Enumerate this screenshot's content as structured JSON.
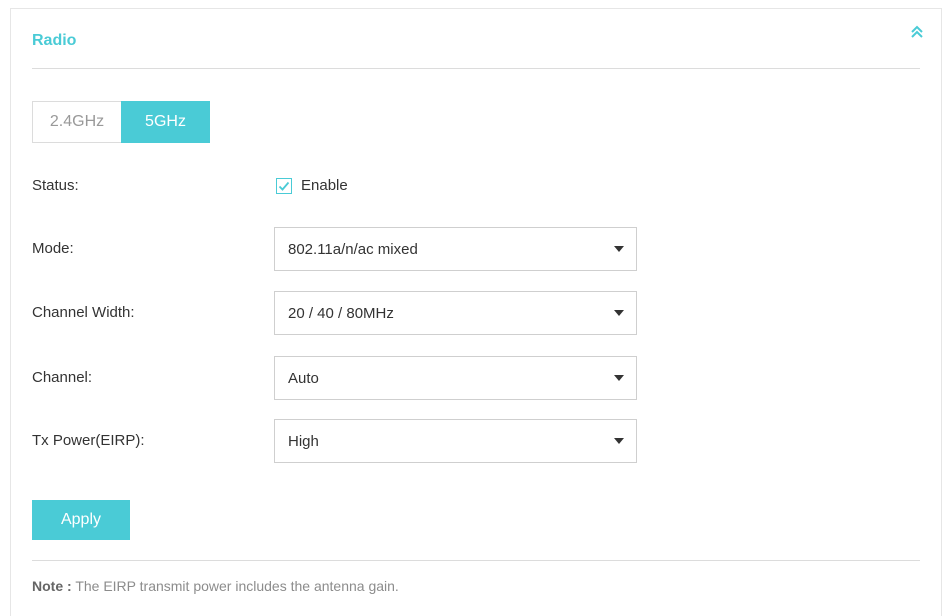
{
  "section": {
    "title": "Radio",
    "collapse_icon": "double-chevron-up-icon"
  },
  "band_tabs": [
    {
      "label": "2.4GHz",
      "active": false
    },
    {
      "label": "5GHz",
      "active": true
    }
  ],
  "status": {
    "label": "Status:",
    "checkbox_label": "Enable",
    "checked": true
  },
  "mode": {
    "label": "Mode:",
    "value": "802.11a/n/ac mixed"
  },
  "channel_width": {
    "label": "Channel Width:",
    "value": "20 / 40 / 80MHz"
  },
  "channel": {
    "label": "Channel:",
    "value": "Auto"
  },
  "tx_power": {
    "label": "Tx Power(EIRP):",
    "value": "High"
  },
  "apply_label": "Apply",
  "note": {
    "prefix": "Note :",
    "text": "The EIRP transmit power includes the antenna gain."
  },
  "colors": {
    "accent": "#4acbd6",
    "text": "#333333",
    "muted": "#999999",
    "border": "#dcdcdc"
  }
}
